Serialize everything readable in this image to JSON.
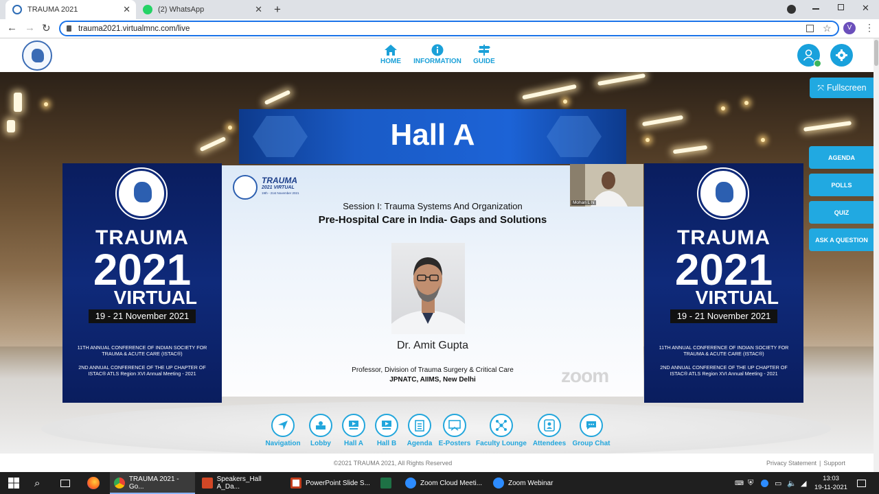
{
  "browser": {
    "tabs": [
      {
        "title": "TRAUMA 2021",
        "active": true
      },
      {
        "title": "(2) WhatsApp",
        "active": false
      }
    ],
    "new_tab": "+",
    "url": "trauma2021.virtualmnc.com/live",
    "profile_initial": "V"
  },
  "header": {
    "nav": [
      {
        "label": "HOME",
        "icon": "home-icon"
      },
      {
        "label": "INFORMATION",
        "icon": "info-icon"
      },
      {
        "label": "GUIDE",
        "icon": "signpost-icon"
      }
    ]
  },
  "hall": {
    "banner": "Hall A",
    "fullscreen_label": "Fullscreen",
    "right_buttons": [
      "AGENDA",
      "POLLS",
      "QUIZ",
      "ASK A QUESTION"
    ]
  },
  "side_panel": {
    "line1": "TRAUMA",
    "line2": "2021",
    "line3": "VIRTUAL",
    "dates": "19 - 21 November 2021",
    "conf1": "11TH ANNUAL CONFERENCE OF INDIAN SOCIETY FOR TRAUMA & ACUTE CARE (ISTAC®)",
    "conf2": "2ND ANNUAL CONFERENCE OF THE UP CHAPTER OF ISTAC® ATLS Region XVI Annual Meeting - 2021"
  },
  "slide": {
    "logo_title": "TRAUMA",
    "logo_sub": "2021 VIRTUAL",
    "logo_dates": "19th - 21st November 2021",
    "session": "Session I: Trauma Systems And Organization",
    "title": "Pre-Hospital Care in India- Gaps and Solutions",
    "speaker": "Dr. Amit Gupta",
    "designation": "Professor, Division of Trauma Surgery & Critical Care",
    "institute": "JPNATC, AIIMS, New Delhi",
    "watermark": "zoom"
  },
  "video": {
    "participant": "Mohan L N"
  },
  "bottom_nav": [
    {
      "label": "Navigation",
      "icon": "navigation-icon"
    },
    {
      "label": "Lobby",
      "icon": "lobby-icon"
    },
    {
      "label": "Hall A",
      "icon": "hall-a-icon"
    },
    {
      "label": "Hall B",
      "icon": "hall-b-icon"
    },
    {
      "label": "Agenda",
      "icon": "agenda-icon"
    },
    {
      "label": "E-Posters",
      "icon": "eposters-icon"
    },
    {
      "label": "Faculty Lounge",
      "icon": "faculty-lounge-icon"
    },
    {
      "label": "Attendees",
      "icon": "attendees-icon"
    },
    {
      "label": "Group Chat",
      "icon": "group-chat-icon"
    }
  ],
  "footer": {
    "copyright": "©2021 TRAUMA 2021, All Rights Reserved",
    "privacy": "Privacy Statement",
    "separator": "|",
    "support": "Support"
  },
  "taskbar": {
    "apps": [
      {
        "label": "TRAUMA 2021 - Go...",
        "active": true
      },
      {
        "label": "Speakers_Hall A_Da...",
        "active": false
      },
      {
        "label": "PowerPoint Slide S...",
        "active": false
      },
      {
        "label": "",
        "active": false
      },
      {
        "label": "Zoom Cloud Meeti...",
        "active": false
      },
      {
        "label": "Zoom Webinar",
        "active": false
      }
    ],
    "time": "13:03",
    "date": "19-11-2021"
  },
  "colors": {
    "accent": "#21a9e1",
    "banner_blue": "#1a5bc6",
    "panel_navy": "#0f2a7a"
  }
}
